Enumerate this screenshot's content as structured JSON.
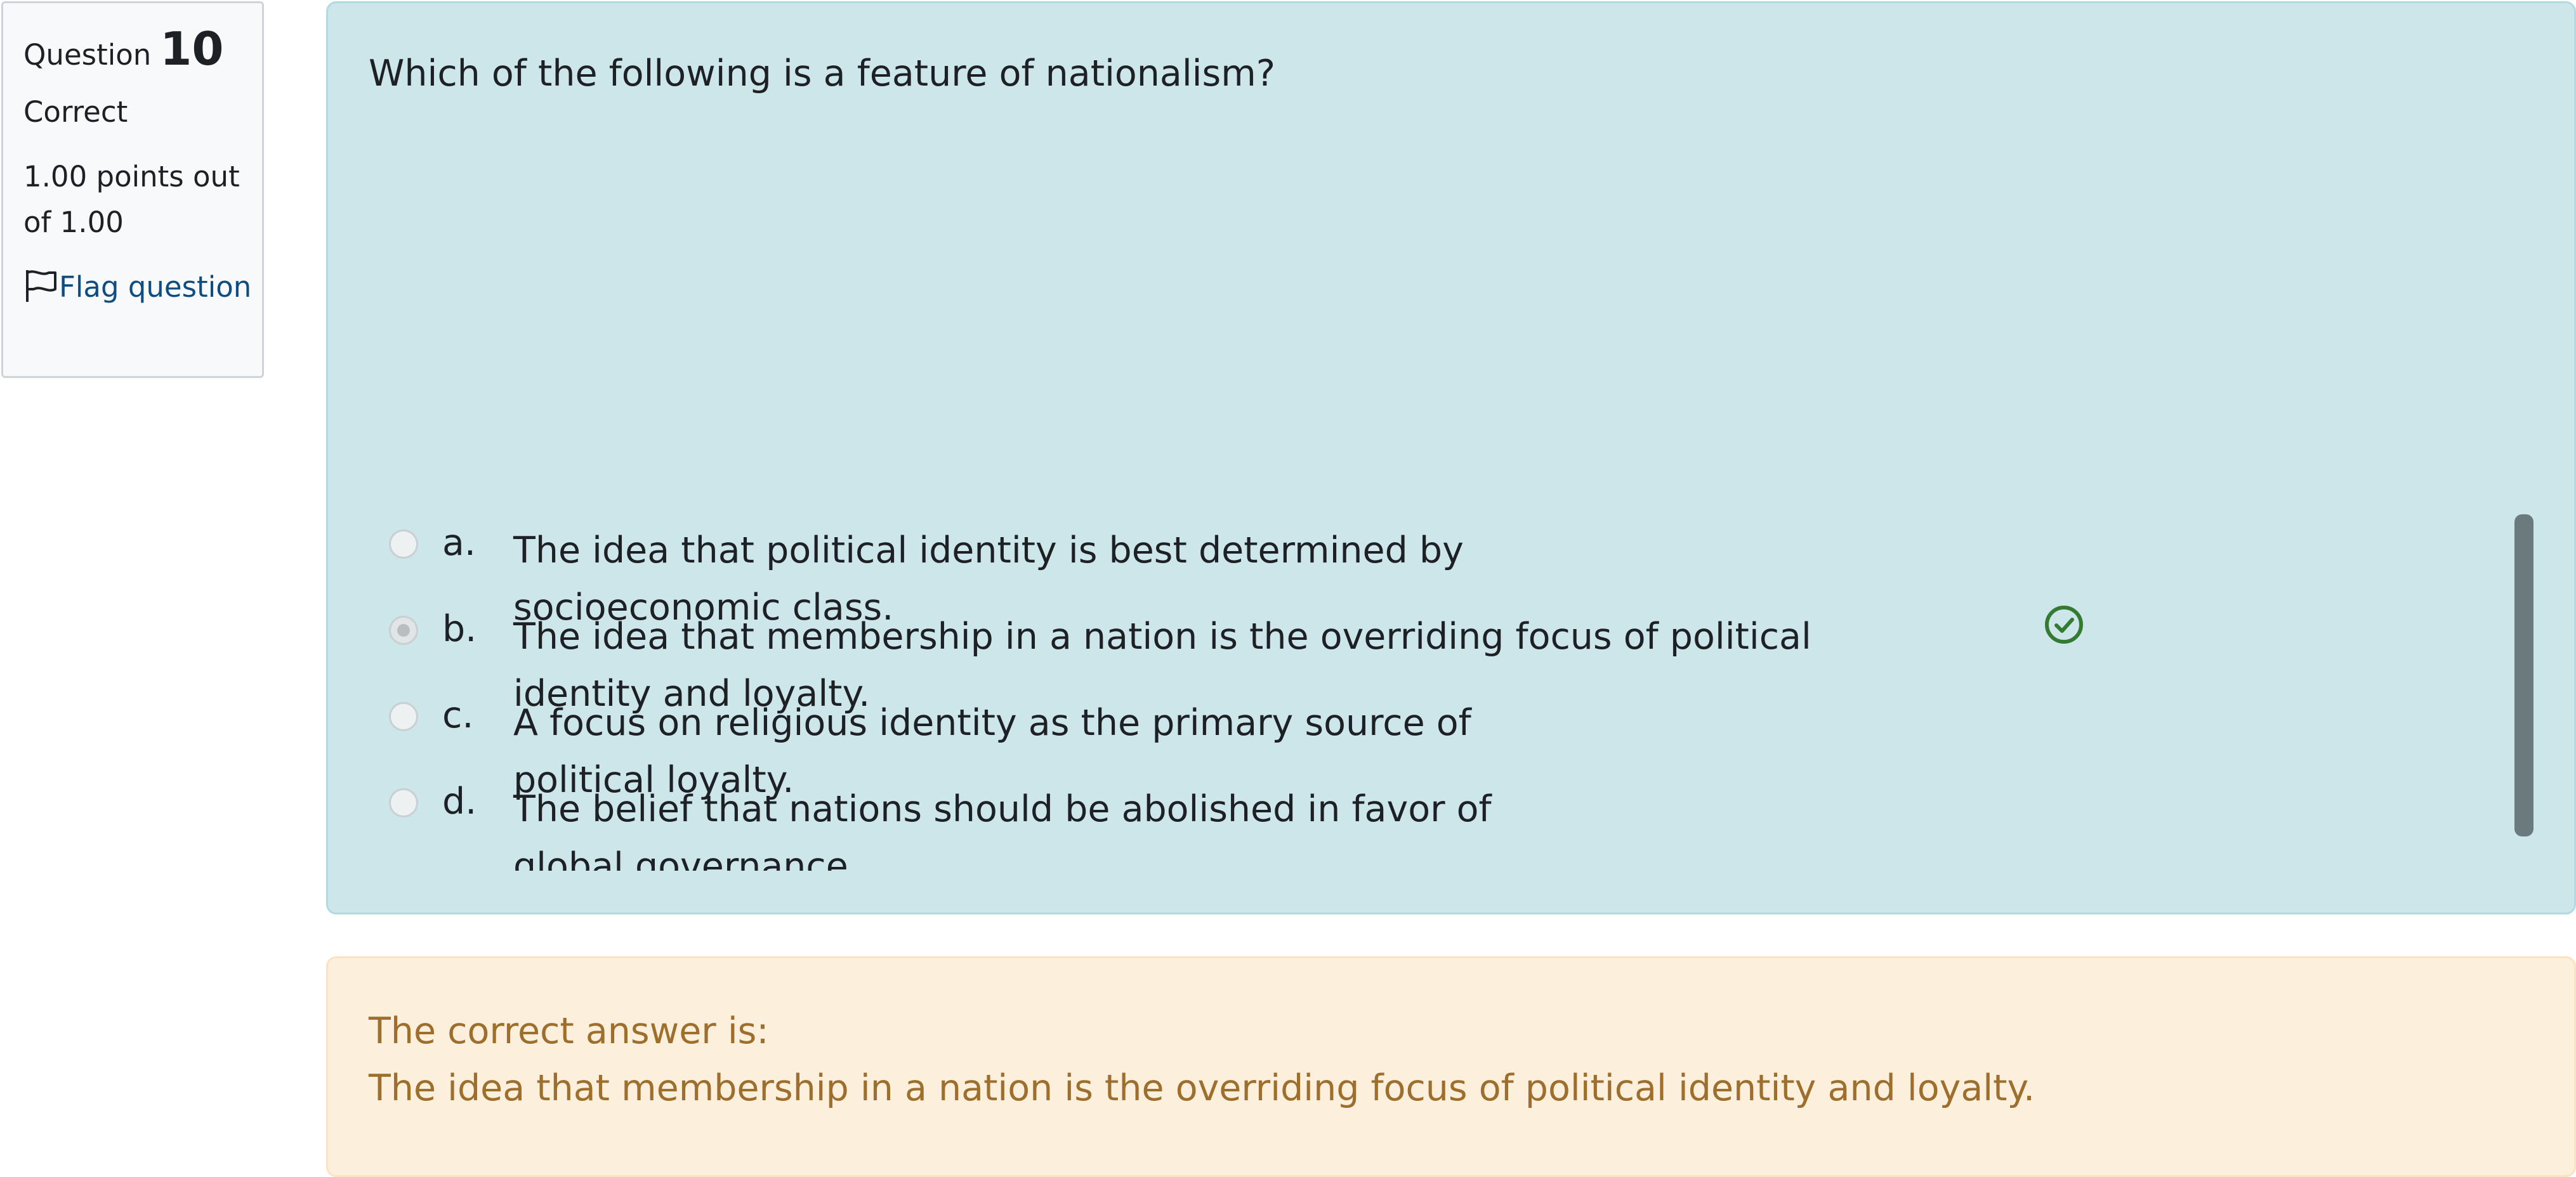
{
  "info": {
    "question_label": "Question",
    "question_number": "10",
    "state": "Correct",
    "grade": "1.00 points out of 1.00",
    "flag_label": "Flag question"
  },
  "question": {
    "text": "Which of the following is a feature of nationalism?",
    "options": [
      {
        "letter": "a.",
        "text": "The idea that political identity is best determined by socioeconomic class.",
        "selected": false,
        "correct_mark": false
      },
      {
        "letter": "b.",
        "text": "The idea that membership in a nation is the overriding focus of political identity and loyalty.",
        "selected": true,
        "correct_mark": true
      },
      {
        "letter": "c.",
        "text": "A focus on religious identity as the primary source of political loyalty.",
        "selected": false,
        "correct_mark": false
      },
      {
        "letter": "d.",
        "text": "The belief that nations should be abolished in favor of global governance.",
        "selected": false,
        "correct_mark": false
      }
    ]
  },
  "feedback": {
    "title": "The correct answer is:",
    "answer": "The idea that membership in a nation is the overriding focus of political identity and loyalty."
  },
  "colors": {
    "formulation_bg": "#cde6ea",
    "feedback_bg": "#fcefdc",
    "feedback_text": "#9d6e2c",
    "correct_green": "#357a32",
    "link_blue": "#0f4c81"
  },
  "icons": {
    "flag": "flag-icon",
    "correct": "check-circle-icon"
  }
}
